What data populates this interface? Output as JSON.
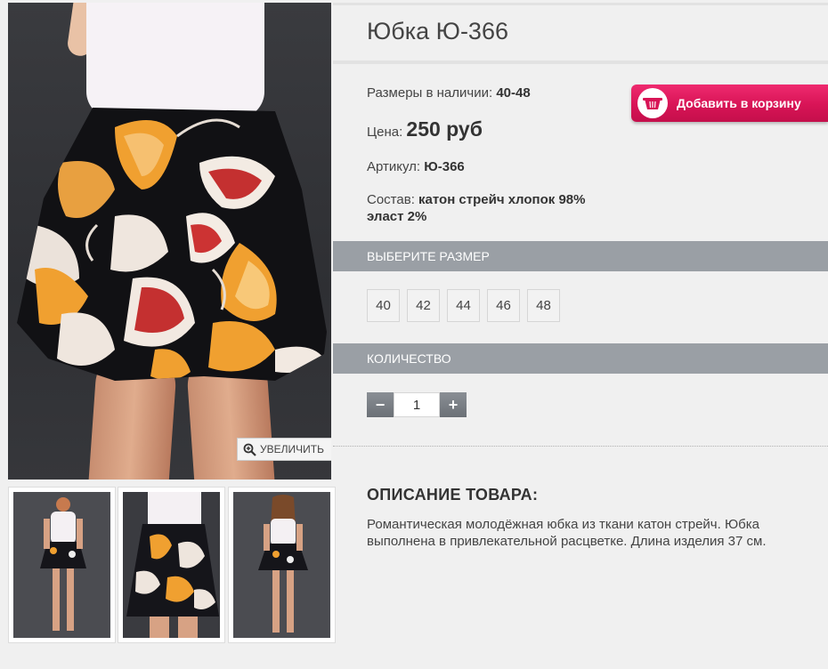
{
  "product": {
    "title": "Юбка Ю-366",
    "sizes_label": "Размеры в наличии:",
    "sizes_value": "40-48",
    "price_label": "Цена:",
    "price_value": "250 руб",
    "article_label": "Артикул:",
    "article_value": "Ю-366",
    "composition_label": "Состав:",
    "composition_line1": "катон стрейч хлопок 98%",
    "composition_line2": "эласт 2%"
  },
  "cart": {
    "add_label": "Добавить в корзину",
    "icon": "basket-icon"
  },
  "gallery": {
    "zoom_label": "УВЕЛИЧИТЬ",
    "zoom_icon": "magnifier-plus-icon"
  },
  "size_section": {
    "title": "ВЫБЕРИТЕ РАЗМЕР",
    "sizes": [
      "40",
      "42",
      "44",
      "46",
      "48"
    ]
  },
  "quantity_section": {
    "title": "КОЛИЧЕСТВО",
    "minus": "−",
    "plus": "+",
    "value": "1"
  },
  "description": {
    "title": "ОПИСАНИЕ ТОВАРА:",
    "text": "Романтическая молодёжная юбка из ткани катон стрейч. Юбка выполнена в привлекательной расцветке. Длина изделия 37 см."
  },
  "colors": {
    "accent": "#d81456",
    "section_bar": "#9a9fa5",
    "background": "#f0f0f0"
  }
}
